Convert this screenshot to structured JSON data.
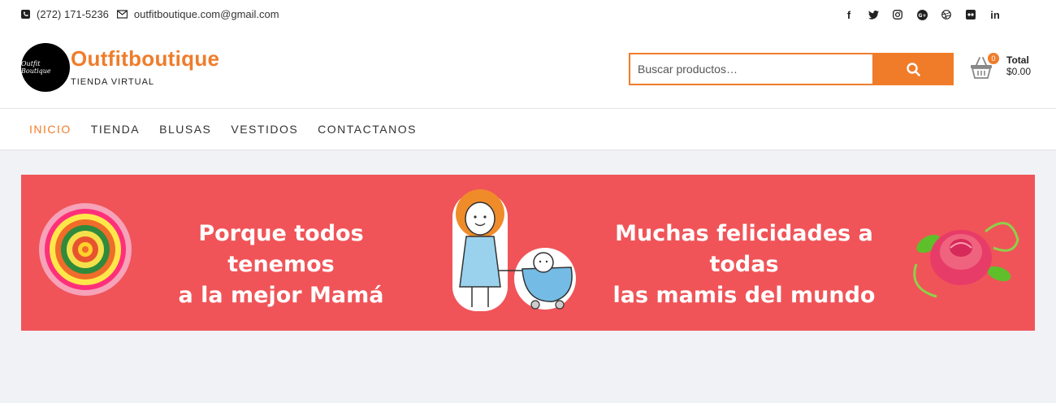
{
  "topbar": {
    "phone": "(272) 171-5236",
    "email": "outfitboutique.com@gmail.com",
    "social_icons": [
      "facebook-icon",
      "twitter-icon",
      "instagram-icon",
      "google-plus-icon",
      "dribbble-icon",
      "flickr-icon",
      "linkedin-icon"
    ]
  },
  "brand": {
    "logo_text": "Outfit Boutique",
    "name": "Outfitboutique",
    "tagline": "TIENDA VIRTUAL"
  },
  "search": {
    "placeholder": "Buscar productos…"
  },
  "cart": {
    "count": "0",
    "total_label": "Total",
    "total_value": "$0.00"
  },
  "nav": {
    "items": [
      "INICIO",
      "TIENDA",
      "BLUSAS",
      "VESTIDOS",
      "CONTACTANOS"
    ],
    "active": "INICIO"
  },
  "banner": {
    "left_line1": "Porque todos tenemos",
    "left_line2": "a la mejor Mamá",
    "right_line1": "Muchas felicidades a todas",
    "right_line2": "las mamis del mundo",
    "background": "#f05458"
  },
  "colors": {
    "accent": "#f07c2a"
  }
}
